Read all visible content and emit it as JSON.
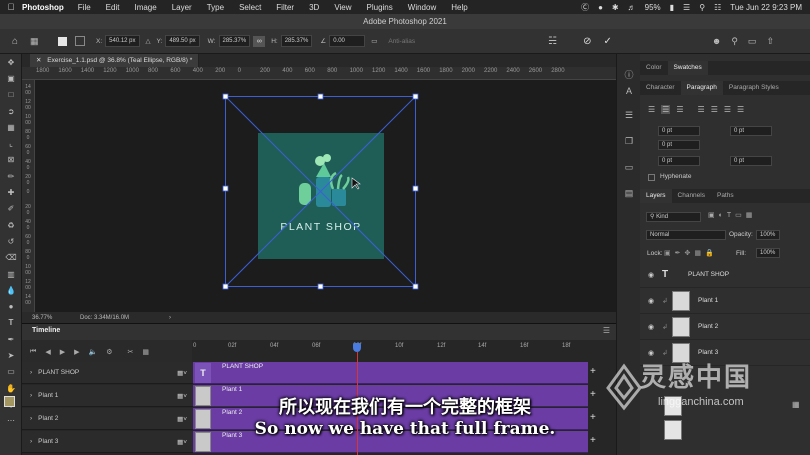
{
  "menubar": {
    "app": "Photoshop",
    "items": [
      "File",
      "Edit",
      "Image",
      "Layer",
      "Type",
      "Select",
      "Filter",
      "3D",
      "View",
      "Plugins",
      "Window",
      "Help"
    ],
    "battery": "95%",
    "clock": "Tue Jun 22  9:23 PM"
  },
  "window_title": "Adobe Photoshop 2021",
  "options": {
    "x_label": "X:",
    "x_value": "540.12 px",
    "y_label": "Y:",
    "y_value": "489.50 px",
    "w_label": "W:",
    "w_value": "285.37%",
    "h_label": "H:",
    "h_value": "285.37%",
    "angle_value": "0.00",
    "antialias": "Anti-alias"
  },
  "document": {
    "tab": "Exercise_1.1.psd @ 36.8% (Teal Ellipse, RGB/8) *",
    "ruler_ticks": [
      "1800",
      "1600",
      "1400",
      "1200",
      "1000",
      "800",
      "600",
      "400",
      "200",
      "0",
      "200",
      "400",
      "600",
      "800",
      "1000",
      "1200",
      "1400",
      "1600",
      "1800",
      "2000",
      "2200",
      "2400",
      "2600",
      "2800"
    ],
    "vruler_ticks": [
      "1400",
      "1200",
      "1000",
      "800",
      "600",
      "400",
      "200",
      "0",
      "200",
      "400",
      "600",
      "800",
      "1000",
      "1200",
      "1400"
    ],
    "artwork_title": "PLANT SHOP",
    "zoom": "36.77%",
    "doc_size": "Doc: 3.34M/16.0M"
  },
  "timeline": {
    "title": "Timeline",
    "frames": [
      "0",
      "02f",
      "04f",
      "06f",
      "08f",
      "10f",
      "12f",
      "14f",
      "16f",
      "18f"
    ],
    "tracks": [
      {
        "name": "PLANT SHOP",
        "clip": "PLANT SHOP"
      },
      {
        "name": "Plant 1",
        "clip": "Plant 1"
      },
      {
        "name": "Plant 2",
        "clip": "Plant 2"
      },
      {
        "name": "Plant 3",
        "clip": "Plant 3"
      }
    ]
  },
  "panels": {
    "top_tabs": [
      "Color",
      "Swatches"
    ],
    "char_tabs": [
      "Character",
      "Paragraph",
      "Paragraph Styles"
    ],
    "para_values": [
      "0 pt",
      "0 pt",
      "0 pt",
      "0 pt",
      "0 pt"
    ],
    "hyphenate": "Hyphenate",
    "layer_tabs": [
      "Layers",
      "Channels",
      "Paths"
    ],
    "kind": "Kind",
    "blend_mode": "Normal",
    "opacity_label": "Opacity:",
    "opacity_value": "100%",
    "lock_label": "Lock:",
    "fill_label": "Fill:",
    "fill_value": "100%",
    "layers": [
      "PLANT SHOP",
      "Plant 1",
      "Plant 2",
      "Plant 3"
    ]
  },
  "subtitles": {
    "cn": "所以现在我们有一个完整的框架",
    "en": "So now we have that full frame."
  },
  "watermark": {
    "text": "灵感中国",
    "url": "lingganchina.com"
  }
}
